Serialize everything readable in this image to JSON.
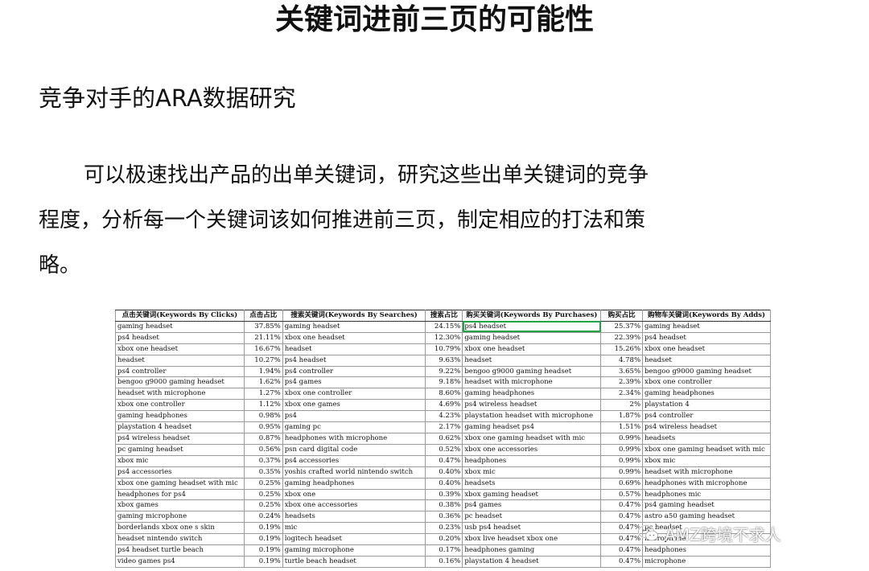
{
  "page": {
    "title": "关键词进前三页的可能性",
    "subtitle": "竞争对手的ARA数据研究",
    "paragraph": "可以极速找出产品的出单关键词，研究这些出单关键词的竞争程度，分析每一个关键词该如何推进前三页，制定相应的打法和策略。"
  },
  "sheet": {
    "headers": [
      "点击关键词(Keywords By Clicks)",
      "点击占比",
      "搜索关键词(Keywords By Searches)",
      "搜索占比",
      "购买关键词(Keywords By Purchases)",
      "购买占比",
      "购物车关键词(Keywords By Adds)"
    ],
    "rows": [
      [
        "gaming headset",
        "37.85%",
        "gaming headset",
        "24.15%",
        "ps4 headset",
        "25.37%",
        "gaming headset"
      ],
      [
        "ps4 headset",
        "21.11%",
        "xbox one headset",
        "12.30%",
        "gaming headset",
        "22.39%",
        "ps4 headset"
      ],
      [
        "xbox one headset",
        "16.67%",
        "headset",
        "10.79%",
        "xbox one headset",
        "15.26%",
        "xbox one headset"
      ],
      [
        "headset",
        "10.27%",
        "ps4 headset",
        "9.63%",
        "headset",
        "4.78%",
        "headset"
      ],
      [
        "ps4 controller",
        "1.94%",
        "ps4 controller",
        "9.22%",
        "bengoo g9000 gaming headset",
        "3.65%",
        "bengoo g9000 gaming headset"
      ],
      [
        "bengoo g9000 gaming headset",
        "1.62%",
        "ps4 games",
        "9.18%",
        "headset with microphone",
        "2.39%",
        "xbox one controller"
      ],
      [
        "headset with microphone",
        "1.27%",
        "xbox one controller",
        "8.60%",
        "gaming headphones",
        "2.34%",
        "gaming headphones"
      ],
      [
        "xbox one controller",
        "1.12%",
        "xbox one games",
        "4.69%",
        "ps4 wireless headset",
        "2%",
        "playstation 4"
      ],
      [
        "gaming headphones",
        "0.98%",
        "ps4",
        "4.23%",
        "playstation headset with microphone",
        "1.87%",
        "ps4 controller"
      ],
      [
        "playstation 4 headset",
        "0.95%",
        "gaming pc",
        "2.17%",
        "gaming headset ps4",
        "1.51%",
        "ps4 wireless headset"
      ],
      [
        "ps4 wireless headset",
        "0.87%",
        "headphones with microphone",
        "0.62%",
        "xbox one gaming headset with mic",
        "0.99%",
        "headsets"
      ],
      [
        "pc gaming headset",
        "0.56%",
        "psn card digital code",
        "0.52%",
        "xbox one accessories",
        "0.99%",
        "xbox one gaming headset with mic"
      ],
      [
        "xbox mic",
        "0.37%",
        "ps4 accessories",
        "0.47%",
        "headphones",
        "0.99%",
        "xbox mic"
      ],
      [
        "ps4 accessories",
        "0.35%",
        "yoshis crafted world nintendo switch",
        "0.40%",
        "xbox mic",
        "0.99%",
        "headset with microphone"
      ],
      [
        "xbox one gaming headset with mic",
        "0.25%",
        "gaming headphones",
        "0.40%",
        "headsets",
        "0.69%",
        "headphones with microphone"
      ],
      [
        "headphones for ps4",
        "0.25%",
        "xbox one",
        "0.39%",
        "xbox gaming headset",
        "0.57%",
        "headphones mic"
      ],
      [
        "xbox games",
        "0.25%",
        "xbox one accessories",
        "0.38%",
        "ps4 games",
        "0.47%",
        "ps4 gaming headset"
      ],
      [
        "gaming microphone",
        "0.24%",
        "headsets",
        "0.36%",
        "pc headset",
        "0.47%",
        "astro a50 gaming headset"
      ],
      [
        "borderlands xbox one s skin",
        "0.19%",
        "mic",
        "0.23%",
        "usb ps4 headset",
        "0.47%",
        "pc headset"
      ],
      [
        "headset nintendo switch",
        "0.19%",
        "logitech headset",
        "0.20%",
        "xbox live headset xbox one",
        "0.47%",
        "microphone"
      ],
      [
        "ps4 headset turtle beach",
        "0.19%",
        "gaming microphone",
        "0.17%",
        "headphones gaming",
        "0.47%",
        "headphones"
      ],
      [
        "video games ps4",
        "0.19%",
        "turtle beach headset",
        "0.16%",
        "playstation 4 headset",
        "0.47%",
        "microphone"
      ]
    ]
  },
  "watermark": {
    "text": "AMZ跨境不求人",
    "icon": "wechat-icon"
  }
}
